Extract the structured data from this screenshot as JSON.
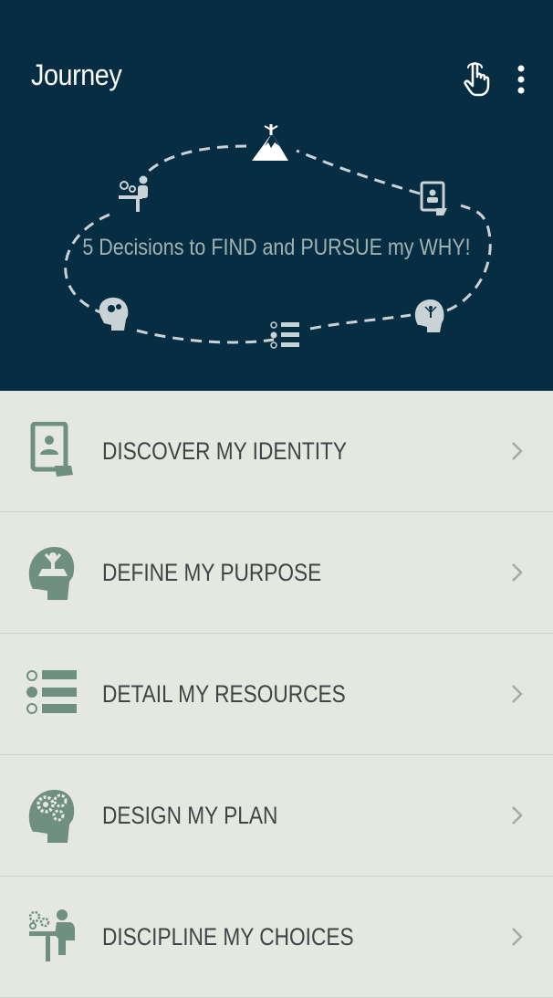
{
  "app": {
    "title": "Journey",
    "tagline": "5 Decisions to FIND and PURSUE my WHY!"
  },
  "toolbar": {
    "tap_icon": "tap-hand-icon",
    "menu_icon": "more-vertical-icon"
  },
  "colors": {
    "header_bg": "#062d42",
    "list_bg": "#e5e8e1",
    "icon_accent": "#6f8f83",
    "text": "#3d4547",
    "path": "#c9d2d4"
  },
  "menu_items": [
    {
      "label": "DISCOVER MY IDENTITY",
      "icon": "identity-tablet-icon"
    },
    {
      "label": "DEFINE MY PURPOSE",
      "icon": "purpose-head-icon"
    },
    {
      "label": "DETAIL MY RESOURCES",
      "icon": "resources-list-icon"
    },
    {
      "label": "DESIGN MY PLAN",
      "icon": "plan-gears-head-icon"
    },
    {
      "label": "DISCIPLINE MY CHOICES",
      "icon": "choices-desk-icon"
    }
  ]
}
